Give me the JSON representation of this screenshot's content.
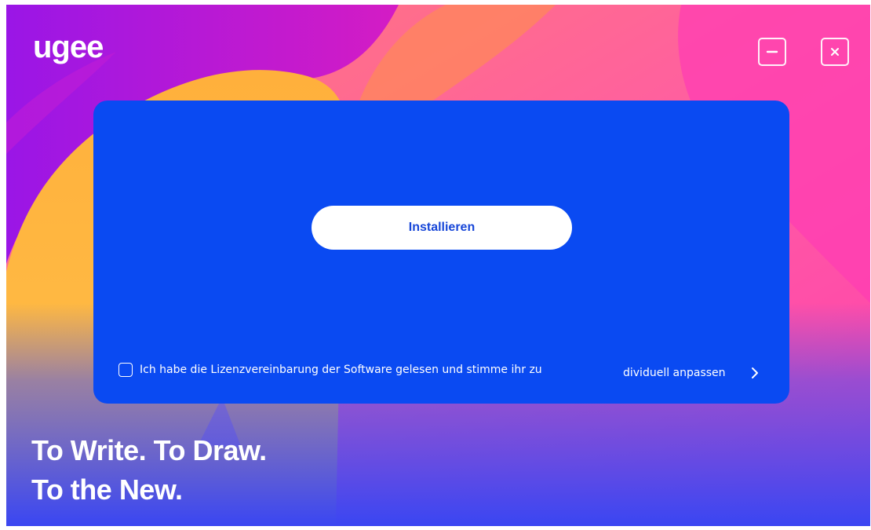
{
  "app": {
    "logo_text": "ugee"
  },
  "window_controls": {
    "minimize_icon": "minimize-icon",
    "close_icon": "close-icon"
  },
  "install": {
    "button_label": "Installieren"
  },
  "license": {
    "checked": false,
    "label": "Ich habe die Lizenzvereinbarung der Software gelesen und stimme ihr zu"
  },
  "customize": {
    "label": "dividuell anpassen",
    "icon": "chevron-right-icon"
  },
  "tagline": {
    "line1": "To Write. To Draw.",
    "line2": "To the New."
  },
  "colors": {
    "card": "#0a4af2",
    "button_text": "#1746d8",
    "purple": "#a81ae0",
    "pink": "#ff4fa6",
    "orange": "#ff8a52",
    "yellow": "#ffb43a"
  }
}
